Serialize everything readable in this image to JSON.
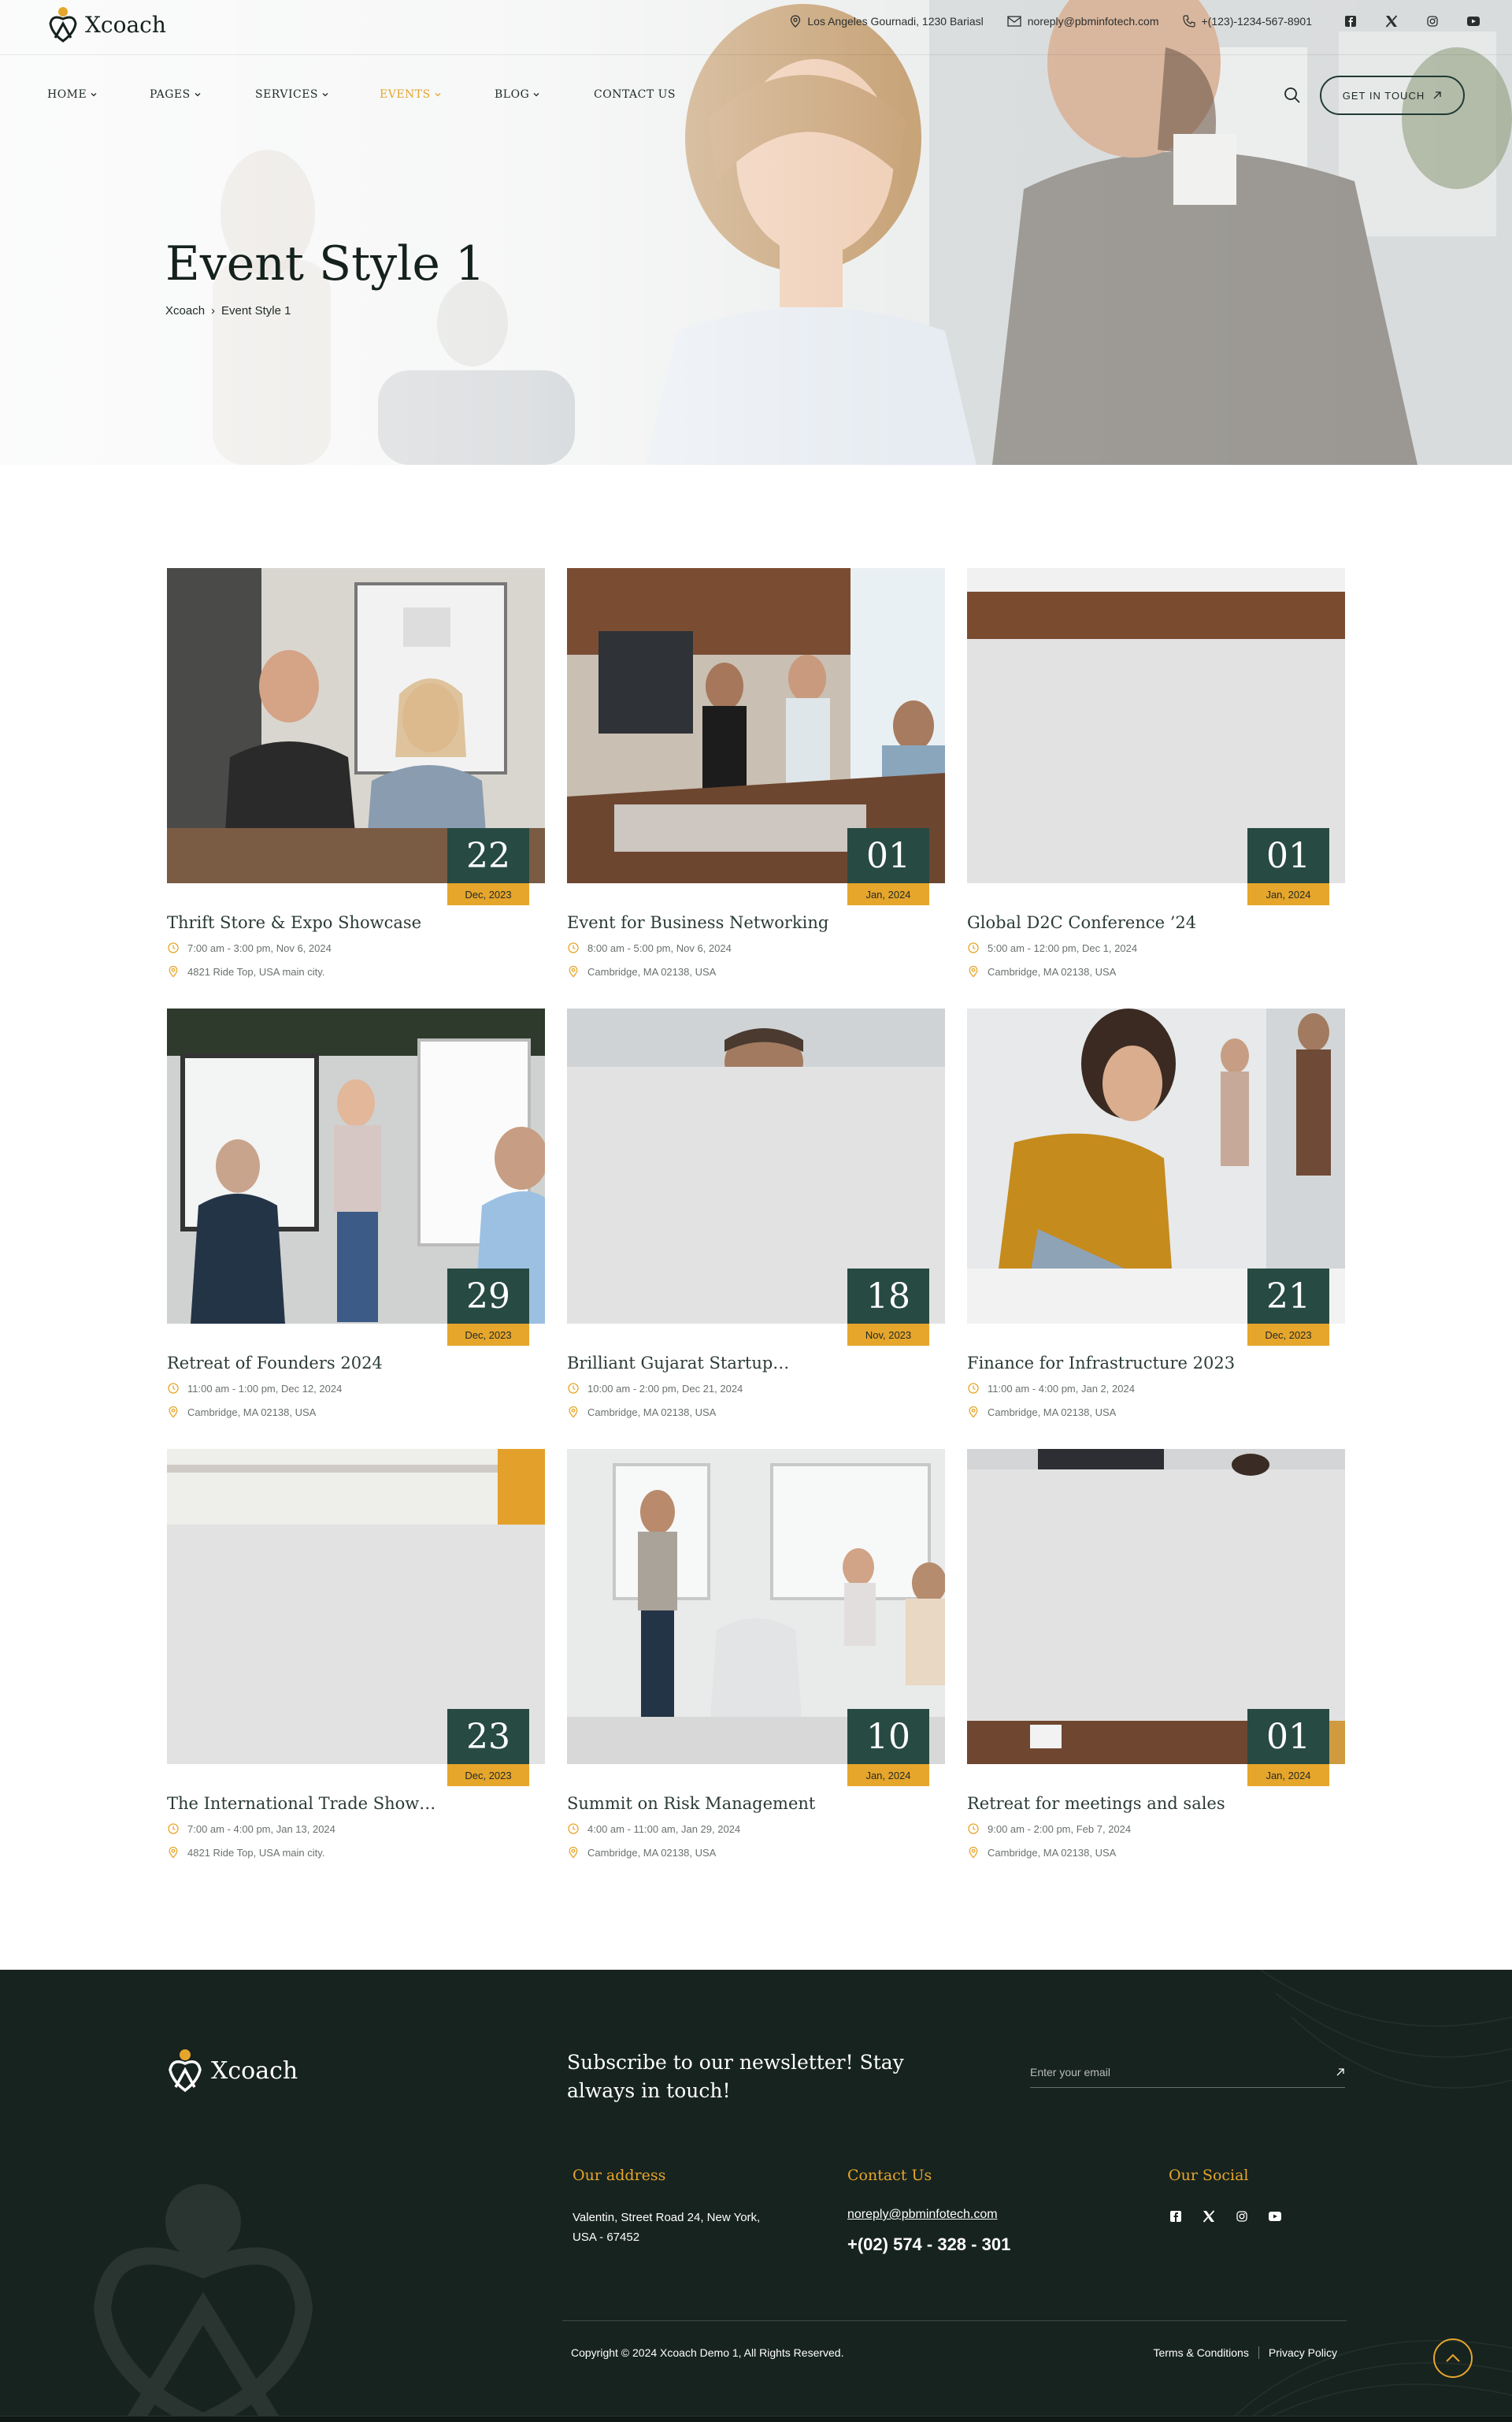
{
  "brand": {
    "name": "Xcoach",
    "accent": "#e6a52b",
    "dark": "#274a42"
  },
  "topbar": {
    "address": "Los Angeles Gournadi, 1230 Bariasl",
    "email": "noreply@pbminfotech.com",
    "phone": "+(123)-1234-567-8901",
    "social": [
      "facebook-icon",
      "x-icon",
      "instagram-icon",
      "youtube-icon"
    ]
  },
  "nav": {
    "items": [
      {
        "label": "HOME",
        "dropdown": true
      },
      {
        "label": "PAGES",
        "dropdown": true
      },
      {
        "label": "SERVICES",
        "dropdown": true
      },
      {
        "label": "EVENTS",
        "dropdown": true,
        "active": true
      },
      {
        "label": "BLOG",
        "dropdown": true
      },
      {
        "label": "CONTACT US",
        "dropdown": false
      }
    ],
    "cta": "GET IN TOUCH"
  },
  "hero": {
    "title": "Event Style 1",
    "breadcrumb": [
      "Xcoach",
      "Event Style 1"
    ]
  },
  "events": [
    {
      "day": "22",
      "month": "Dec, 2023",
      "title": "Thrift Store & Expo Showcase",
      "time": "7:00 am - 3:00 pm, Nov 6, 2024",
      "location": "4821 Ride Top, USA main city."
    },
    {
      "day": "01",
      "month": "Jan, 2024",
      "title": "Event for Business Networking",
      "time": "8:00 am - 5:00 pm, Nov 6, 2024",
      "location": "Cambridge, MA 02138, USA"
    },
    {
      "day": "01",
      "month": "Jan, 2024",
      "title": "Global D2C Conference ’24",
      "time": "5:00 am - 12:00 pm, Dec 1, 2024",
      "location": "Cambridge, MA 02138, USA"
    },
    {
      "day": "29",
      "month": "Dec, 2023",
      "title": "Retreat of Founders 2024",
      "time": "11:00 am - 1:00 pm, Dec 12, 2024",
      "location": "Cambridge, MA 02138, USA"
    },
    {
      "day": "18",
      "month": "Nov, 2023",
      "title": "Brilliant Gujarat Startup…",
      "time": "10:00 am - 2:00 pm, Dec 21, 2024",
      "location": "Cambridge, MA 02138, USA"
    },
    {
      "day": "21",
      "month": "Dec, 2023",
      "title": "Finance for Infrastructure 2023",
      "time": "11:00 am - 4:00 pm, Jan 2, 2024",
      "location": "Cambridge, MA 02138, USA"
    },
    {
      "day": "23",
      "month": "Dec, 2023",
      "title": "The International Trade Show…",
      "time": "7:00 am - 4:00 pm, Jan 13, 2024",
      "location": "4821 Ride Top, USA main city."
    },
    {
      "day": "10",
      "month": "Jan, 2024",
      "title": "Summit on Risk Management",
      "time": "4:00 am - 11:00 am, Jan 29, 2024",
      "location": "Cambridge, MA 02138, USA"
    },
    {
      "day": "01",
      "month": "Jan, 2024",
      "title": "Retreat for meetings and sales",
      "time": "9:00 am - 2:00 pm, Feb 7, 2024",
      "location": "Cambridge, MA 02138, USA"
    }
  ],
  "footer": {
    "newsletter_text": "Subscribe to our newsletter! Stay always in touch!",
    "email_placeholder": "Enter your email",
    "address_heading": "Our address",
    "address": "Valentin, Street Road 24, New York, USA - 67452",
    "contact_heading": "Contact Us",
    "contact_email": "noreply@pbminfotech.com",
    "contact_phone": "+(02) 574 - 328 - 301",
    "social_heading": "Our Social",
    "copyright": "Copyright © 2024 Xcoach Demo 1, All Rights Reserved.",
    "terms": "Terms & Conditions",
    "privacy": "Privacy Policy"
  }
}
